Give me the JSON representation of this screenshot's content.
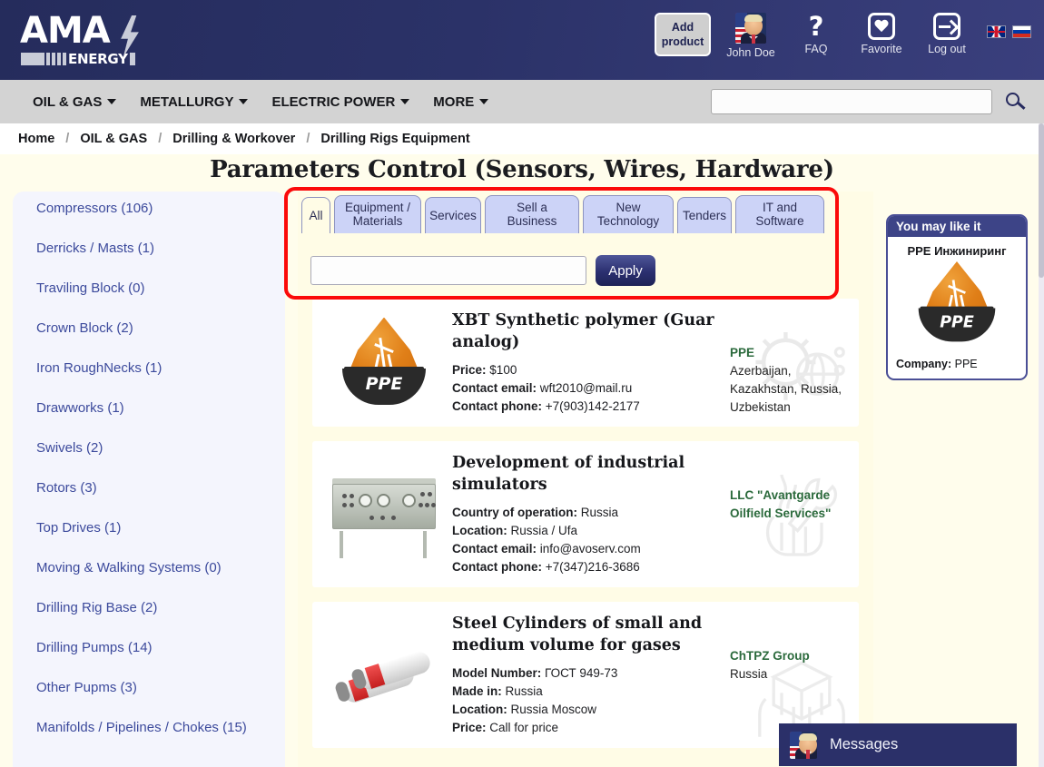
{
  "header": {
    "logo_main": "AMA",
    "logo_sub": "ENERGY",
    "add_product": "Add\nproduct",
    "add_product_label": "Add product",
    "user_name": "John Doe",
    "faq_label": "FAQ",
    "favorite_label": "Favorite",
    "logout_label": "Log out",
    "flag_en": "flag-uk-icon",
    "flag_ru": "flag-russia-icon",
    "brand_color": "#2b3268"
  },
  "nav": {
    "items": [
      {
        "label": "OIL & GAS",
        "has_caret": true
      },
      {
        "label": "METALLURGY",
        "has_caret": true
      },
      {
        "label": "ELECTRIC POWER",
        "has_caret": true
      },
      {
        "label": "MORE",
        "has_caret": true
      }
    ],
    "search_value": "",
    "search_placeholder": ""
  },
  "breadcrumb": {
    "items": [
      "Home",
      "OIL & GAS",
      "Drilling & Workover",
      "Drilling Rigs Equipment"
    ],
    "separator": "/"
  },
  "page": {
    "title": "Parameters Control (Sensors, Wires, Hardware)"
  },
  "sidebar": {
    "categories": [
      "Compressors (106)",
      "Derricks / Masts (1)",
      "Traviling Block (0)",
      "Crown Block (2)",
      "Iron RoughNecks (1)",
      "Drawworks (1)",
      "Swivels (2)",
      "Rotors (3)",
      "Top Drives (1)",
      "Moving & Walking Systems (0)",
      "Drilling Rig Base (2)",
      "Drilling Pumps (14)",
      "Other Pupms (3)",
      "Manifolds / Pipelines / Chokes (15)"
    ]
  },
  "tabs": [
    {
      "label": "All",
      "active": true
    },
    {
      "label": "Equipment / Materials",
      "active": false
    },
    {
      "label": "Services",
      "active": false
    },
    {
      "label": "Sell a Business",
      "active": false
    },
    {
      "label": "New Technology",
      "active": false
    },
    {
      "label": "Tenders",
      "active": false
    },
    {
      "label": "IT and Software",
      "active": false
    }
  ],
  "filter": {
    "input_value": "",
    "input_placeholder": "",
    "apply_label": "Apply"
  },
  "highlight": {
    "color": "#fb0a0a"
  },
  "listings": [
    {
      "title": "XBT Synthetic polymer (Guar analog)",
      "thumb": "ppe-logo-image",
      "specs": [
        {
          "label": "Price:",
          "value": "$100"
        },
        {
          "label": "Contact email:",
          "value": "wft2010@mail.ru"
        },
        {
          "label": "Contact phone:",
          "value": "+7(903)142-2177"
        }
      ],
      "company": "PPE",
      "location": "Azerbaijan, Kazakhstan, Russia, Uzbekistan",
      "watermark": "gear-globe-icon"
    },
    {
      "title": "Development of industrial simulators",
      "thumb": "control-panel-photo",
      "specs": [
        {
          "label": "Country of operation:",
          "value": "Russia"
        },
        {
          "label": "Location:",
          "value": "Russia / Ufa"
        },
        {
          "label": "Contact email:",
          "value": "info@avoserv.com"
        },
        {
          "label": "Contact phone:",
          "value": "+7(347)216-3686"
        }
      ],
      "company": "LLC \"Avantgarde Oilfield Services\"",
      "location": "",
      "watermark": "hand-wrench-icon"
    },
    {
      "title": "Steel Cylinders of small and medium volume for gases",
      "thumb": "gas-cylinders-image",
      "specs": [
        {
          "label": "Model Number:",
          "value": "ГОСТ 949-73"
        },
        {
          "label": "Made in:",
          "value": "Russia"
        },
        {
          "label": "Location:",
          "value": "Russia Moscow"
        },
        {
          "label": "Price:",
          "value": "Call for price"
        }
      ],
      "company": "ChTPZ Group",
      "location": "Russia",
      "watermark": "hands-box-icon"
    }
  ],
  "right_panel": {
    "header": "You may like it",
    "title": "PPE Инжиниринг",
    "logo": "ppe-logo-image",
    "company_label": "Company:",
    "company_value": "PPE"
  },
  "messages": {
    "label": "Messages",
    "avatar": "user-avatar-icon"
  }
}
